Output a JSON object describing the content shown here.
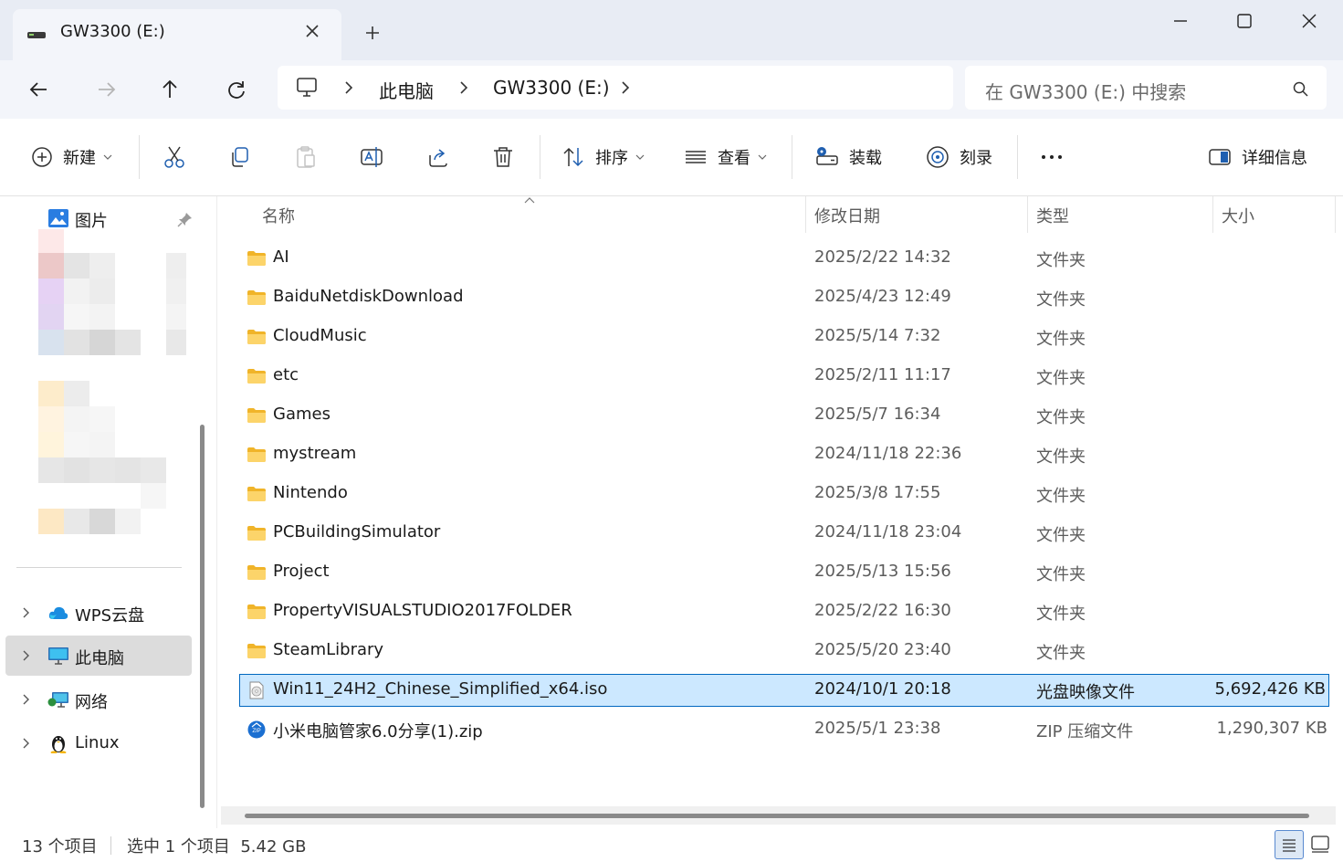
{
  "window": {
    "tab_title": "GW3300 (E:)",
    "tab_icon": "drive-icon",
    "new_tab_icon": "plus-icon",
    "controls": [
      "minimize-icon",
      "maximize-icon",
      "close-icon"
    ]
  },
  "nav": {
    "buttons": [
      "back-arrow-icon",
      "forward-arrow-icon",
      "up-arrow-icon",
      "refresh-icon"
    ],
    "breadcrumb": [
      "此电脑",
      "GW3300 (E:)"
    ],
    "search_placeholder": "在 GW3300 (E:) 中搜索"
  },
  "toolbar": {
    "new_label": "新建",
    "sort_label": "排序",
    "view_label": "查看",
    "mount_label": "装载",
    "burn_label": "刻录",
    "details_label": "详细信息",
    "icons": [
      "cut-icon",
      "copy-icon",
      "paste-icon",
      "rename-icon",
      "share-icon",
      "delete-icon",
      "more-icon"
    ]
  },
  "sidebar": {
    "quick_item": "图片",
    "items": [
      {
        "label": "WPS云盘",
        "icon": "cloud-icon",
        "selected": false
      },
      {
        "label": "此电脑",
        "icon": "computer-icon",
        "selected": true
      },
      {
        "label": "网络",
        "icon": "network-icon",
        "selected": false
      },
      {
        "label": "Linux",
        "icon": "penguin-icon",
        "selected": false
      }
    ]
  },
  "columns": {
    "name": "名称",
    "date": "修改日期",
    "type": "类型",
    "size": "大小"
  },
  "files": [
    {
      "name": "AI",
      "date": "2025/2/22 14:32",
      "type": "文件夹",
      "size": "",
      "icon": "folder-icon"
    },
    {
      "name": "BaiduNetdiskDownload",
      "date": "2025/4/23 12:49",
      "type": "文件夹",
      "size": "",
      "icon": "folder-icon"
    },
    {
      "name": "CloudMusic",
      "date": "2025/5/14 7:32",
      "type": "文件夹",
      "size": "",
      "icon": "folder-icon"
    },
    {
      "name": "etc",
      "date": "2025/2/11 11:17",
      "type": "文件夹",
      "size": "",
      "icon": "folder-icon"
    },
    {
      "name": "Games",
      "date": "2025/5/7 16:34",
      "type": "文件夹",
      "size": "",
      "icon": "folder-icon"
    },
    {
      "name": "mystream",
      "date": "2024/11/18 22:36",
      "type": "文件夹",
      "size": "",
      "icon": "folder-icon"
    },
    {
      "name": "Nintendo",
      "date": "2025/3/8 17:55",
      "type": "文件夹",
      "size": "",
      "icon": "folder-icon"
    },
    {
      "name": "PCBuildingSimulator",
      "date": "2024/11/18 23:04",
      "type": "文件夹",
      "size": "",
      "icon": "folder-icon"
    },
    {
      "name": "Project",
      "date": "2025/5/13 15:56",
      "type": "文件夹",
      "size": "",
      "icon": "folder-icon"
    },
    {
      "name": "PropertyVISUALSTUDIO2017FOLDER",
      "date": "2025/2/22 16:30",
      "type": "文件夹",
      "size": "",
      "icon": "folder-icon"
    },
    {
      "name": "SteamLibrary",
      "date": "2025/5/20 23:40",
      "type": "文件夹",
      "size": "",
      "icon": "folder-icon"
    },
    {
      "name": "Win11_24H2_Chinese_Simplified_x64.iso",
      "date": "2024/10/1 20:18",
      "type": "光盘映像文件",
      "size": "5,692,426 KB",
      "icon": "disc-image-icon",
      "selected": true
    },
    {
      "name": "小米电脑管家6.0分享(1).zip",
      "date": "2025/5/1 23:38",
      "type": "ZIP 压缩文件",
      "size": "1,290,307 KB",
      "icon": "zip-icon"
    }
  ],
  "status": {
    "count": "13 个项目",
    "selection": "选中 1 个项目  5.42 GB"
  },
  "colors": {
    "accent": "#0067c0",
    "selection": "#cce8ff",
    "folder": "#f8c43a"
  }
}
